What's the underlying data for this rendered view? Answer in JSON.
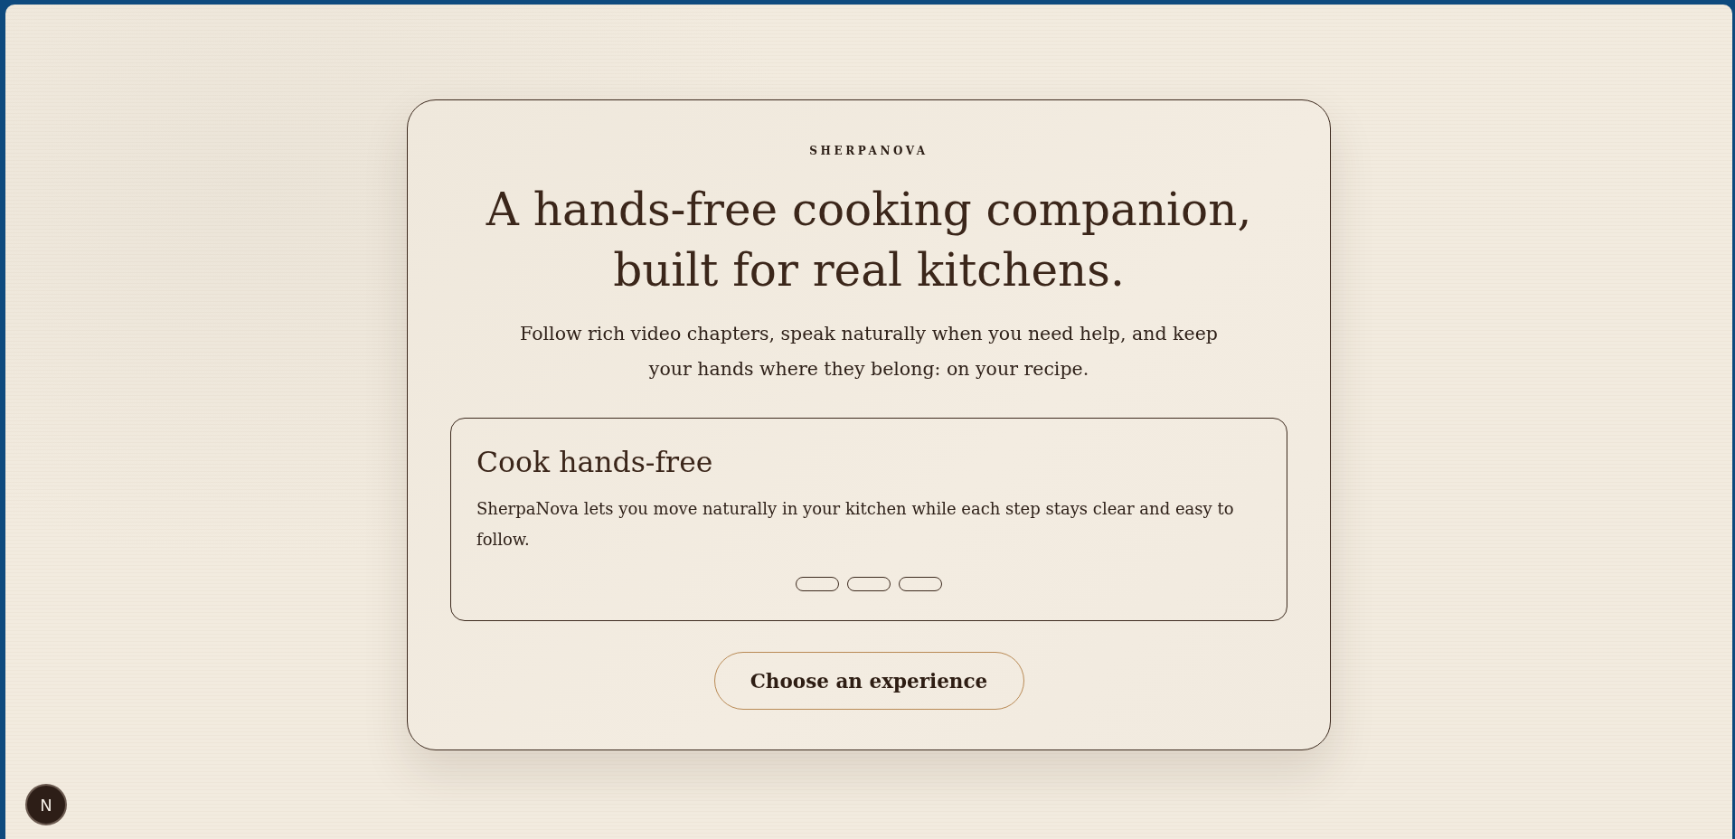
{
  "brand": "SHERPANOVA",
  "headline": "A hands-free cooking companion, built for real kitchens.",
  "subtitle": "Follow rich video chapters, speak naturally when you need help, and keep your hands where they belong: on your recipe.",
  "feature_card": {
    "title": "Cook hands-free",
    "text": "SherpaNova lets you move naturally in your kitchen while each step stays clear and easy to follow.",
    "dots": [
      {
        "selected": false
      },
      {
        "selected": false
      },
      {
        "selected": false
      }
    ]
  },
  "cta_button": {
    "label": "Choose an experience"
  },
  "dev_badge": {
    "label": "N"
  }
}
